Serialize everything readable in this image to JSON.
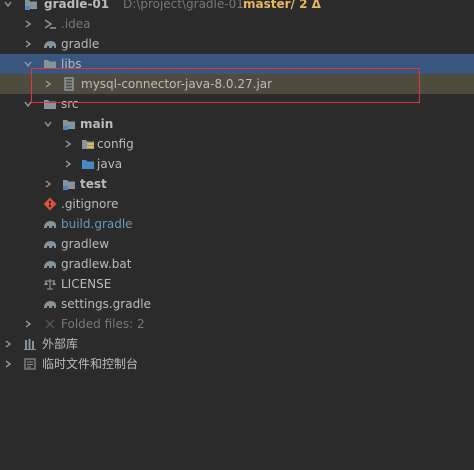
{
  "tree": {
    "root": {
      "label": "gradle-01",
      "path": "D:\\project\\gradle-01",
      "branch": "master/ 2 Δ"
    },
    "items": [
      {
        "label": ".idea"
      },
      {
        "label": "gradle"
      },
      {
        "label": "libs"
      },
      {
        "label": "mysql-connector-java-8.0.27.jar"
      },
      {
        "label": "src"
      },
      {
        "label": "main"
      },
      {
        "label": "config"
      },
      {
        "label": "java"
      },
      {
        "label": "test"
      },
      {
        "label": ".gitignore"
      },
      {
        "label": "build.gradle"
      },
      {
        "label": "gradlew"
      },
      {
        "label": "gradlew.bat"
      },
      {
        "label": "LICENSE"
      },
      {
        "label": "settings.gradle"
      },
      {
        "label": "Folded files: 2"
      }
    ],
    "external_libraries": "外部库",
    "scratches": "临时文件和控制台"
  },
  "colors": {
    "background": "#2b2b2b",
    "selection": "#38567e",
    "highlight": "#4e4c3e",
    "annotation_box": "#e0343c",
    "branch": "#e8b65f",
    "vcs_modified": "#6897bb"
  },
  "icons": {
    "folder": "folder-icon",
    "module": "module-folder-icon",
    "jar": "jar-icon",
    "gradle": "gradle-elephant-icon",
    "git": "git-icon",
    "license": "license-scale-icon",
    "libraries": "libraries-icon",
    "scratches": "scratches-icon"
  }
}
